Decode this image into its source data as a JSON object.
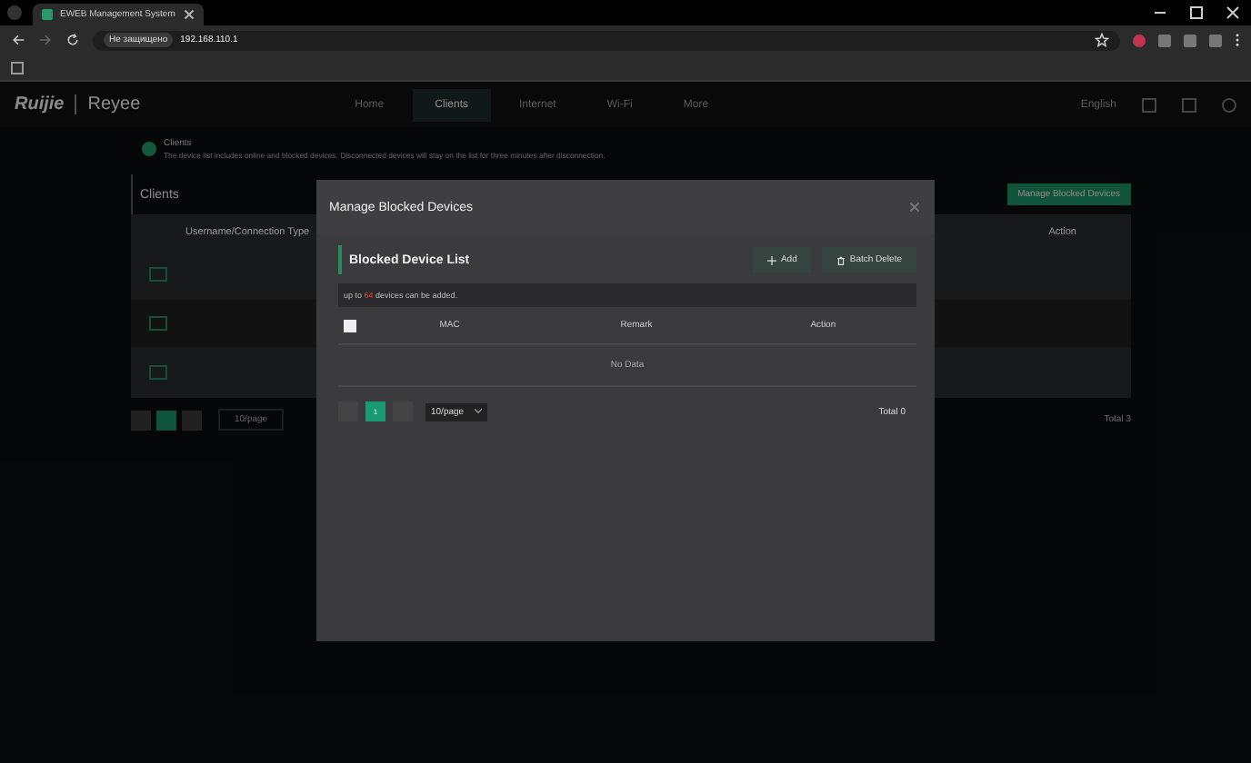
{
  "browser": {
    "tab_title": "EWEB Management System",
    "security_label": "Не защищено",
    "address": "192.168.110.1"
  },
  "header": {
    "brand": "Ruijie",
    "product": "Reyee",
    "nav": [
      {
        "label": "Home",
        "selected": false
      },
      {
        "label": "Clients",
        "selected": true
      },
      {
        "label": "Internet",
        "selected": false
      },
      {
        "label": "Wi-Fi",
        "selected": false
      },
      {
        "label": "More",
        "selected": false
      }
    ],
    "language": "English"
  },
  "page": {
    "info_title": "Clients",
    "info_text": "The device list includes online and blocked devices. Disconnected devices will stay on the list for three minutes after disconnection.",
    "panel_title": "Clients",
    "manage_button": "Manage Blocked Devices",
    "columns": [
      "Username/Connection Type",
      "Action"
    ],
    "rows": [
      {
        "kind": "device"
      },
      {
        "kind": "device"
      },
      {
        "kind": "device"
      }
    ],
    "pages": [
      {
        "selected": false
      },
      {
        "selected": true
      },
      {
        "selected": false
      }
    ],
    "page_size": "10/page",
    "total": "Total 3"
  },
  "modal": {
    "title": "Manage Blocked Devices",
    "section_title": "Blocked Device List",
    "add_button": "Add",
    "delete_button": "Batch Delete",
    "notice": "up to **64** devices can be added.",
    "select_all_checked": false,
    "columns": [
      "MAC",
      "Remark",
      "Action"
    ],
    "empty_text": "No Data",
    "pages": [
      {
        "label": "1",
        "selected": true
      }
    ],
    "page_size": "10/page",
    "total": "Total 0"
  }
}
